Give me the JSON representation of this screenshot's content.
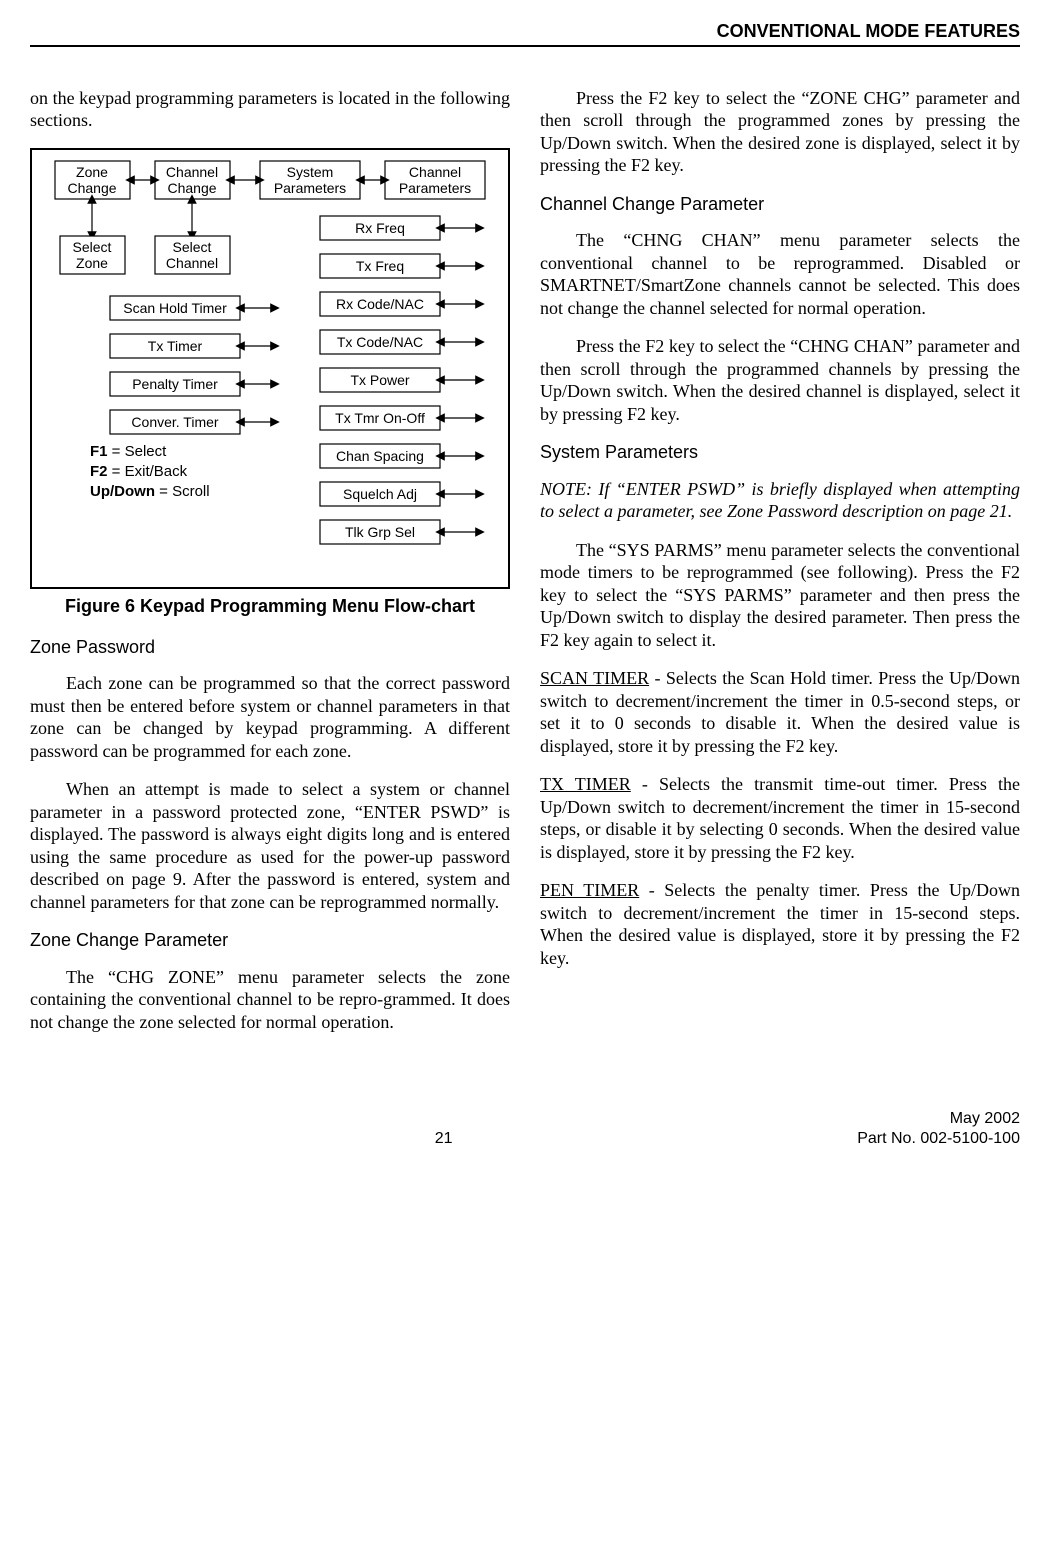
{
  "header": {
    "title": "CONVENTIONAL MODE FEATURES"
  },
  "col1": {
    "intro": "on the keypad programming parameters is located in the following sections.",
    "fig_caption": "Figure 6   Keypad Programming Menu Flow-chart",
    "sec_zone_pwd": "Zone Password",
    "p1": "Each zone can be programmed so that the correct password must then be entered before system or channel parameters in that zone can be changed by keypad programming. A different password can be programmed for each zone.",
    "p2": "When an attempt is made to select a system or channel parameter in a password protected zone, “ENTER PSWD” is displayed. The password is always eight digits long and is entered using the same procedure as used for the power-up password described on page 9. After the password is entered, system and channel parameters for that zone can be reprogrammed normally.",
    "sec_zone_chg": "Zone Change Parameter",
    "p3": "The “CHG ZONE” menu parameter selects the zone containing the conventional channel to be repro-grammed. It does not change the zone selected for normal operation."
  },
  "col2": {
    "p1": "Press the F2 key to select the “ZONE CHG” parameter and then scroll through the programmed zones by pressing the Up/Down switch. When the desired zone is displayed, select it by pressing the F2 key.",
    "sec_chan_chg": "Channel Change Parameter",
    "p2": "The “CHNG CHAN” menu parameter selects the conventional channel to be reprogrammed. Disabled or SMARTNET/SmartZone channels cannot be selected. This does not change the channel selected for normal operation.",
    "p3": "Press the F2 key to select the “CHNG CHAN” parameter and then scroll through the programmed channels by pressing the Up/Down switch. When the desired channel is displayed, select it by pressing F2 key.",
    "sec_sys_params": "System Parameters",
    "note": "NOTE: If “ENTER PSWD” is briefly displayed when attempting to select a parameter, see Zone Password description on page 21.",
    "p4": "The “SYS PARMS” menu parameter selects the conventional mode timers to be reprogrammed (see following). Press the F2 key to select the “SYS PARMS” parameter and then press the Up/Down switch to display the desired parameter. Then press the F2 key again to select it.",
    "scan_label": "SCAN TIMER",
    "scan_text": " - Selects the Scan Hold timer. Press the Up/Down switch to decrement/increment the timer in 0.5-second steps, or set it to 0 seconds to disable it. When the desired value is displayed, store it by pressing the F2 key.",
    "tx_label": "TX TIMER",
    "tx_text": " - Selects the transmit time-out timer. Press the Up/Down switch to decrement/increment the timer in 15-second steps, or disable it by selecting 0 seconds. When the desired value is displayed, store it by pressing the F2 key.",
    "pen_label": "PEN TIMER",
    "pen_text": " - Selects the penalty timer. Press the Up/Down switch to decrement/increment the timer in 15-second steps. When the desired value is displayed, store it by pressing the F2 key."
  },
  "figure": {
    "top": {
      "zone": "Zone\nChange",
      "channel": "Channel\nChange",
      "system": "System\nParameters",
      "chparams": "Channel\nParameters"
    },
    "left_sub": {
      "selzone": "Select\nZone",
      "selchan": "Select\nChannel"
    },
    "sys_items": [
      "Scan Hold Timer",
      "Tx Timer",
      "Penalty Timer",
      "Conver. Timer"
    ],
    "chan_items": [
      "Rx Freq",
      "Tx Freq",
      "Rx Code/NAC",
      "Tx Code/NAC",
      "Tx Power",
      "Tx Tmr On-Off",
      "Chan Spacing",
      "Squelch Adj",
      "Tlk Grp Sel"
    ],
    "legend": {
      "f1": "F1",
      "f1t": " = Select",
      "f2": "F2",
      "f2t": " = Exit/Back",
      "ud": "Up/Down",
      "udt": " = Scroll"
    }
  },
  "footer": {
    "page": "21",
    "date": "May 2002",
    "part": "Part No. 002-5100-100"
  }
}
